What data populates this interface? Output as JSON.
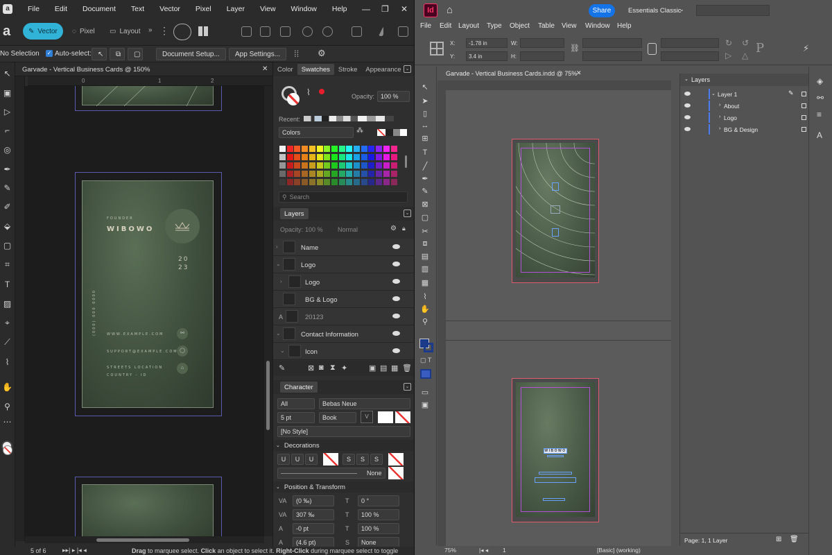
{
  "affinity": {
    "menus": [
      "File",
      "Edit",
      "Document",
      "Text",
      "Vector",
      "Pixel",
      "Layer",
      "View",
      "Window",
      "Help"
    ],
    "personas": {
      "vector": "Vector",
      "pixel": "Pixel",
      "layout": "Layout"
    },
    "context": {
      "selection": "No Selection",
      "auto_select": "Auto-select:",
      "document_setup": "Document Setup...",
      "app_settings": "App Settings..."
    },
    "doc_tab": "Garvade - Vertical Business Cards @ 150%",
    "ruler_ticks": [
      "0",
      "1",
      "2"
    ],
    "card": {
      "role": "FOUNDER",
      "name": "WIBOWO",
      "year_top": "20",
      "year_bottom": "23",
      "phone": "(000) 000 0000",
      "website": "WWW.EXAMPLE.COM",
      "email": "SUPPORT@EXAMPLE.COM",
      "street": "STREETS LOCATION",
      "country": "COUNTRY - ID"
    },
    "swatches_panel": {
      "tabs": [
        "Color",
        "Swatches",
        "Stroke",
        "Appearance"
      ],
      "selected_tab": "Swatches",
      "opacity_label": "Opacity:",
      "opacity_value": "100 %",
      "recent_label": "Recent:",
      "palette": "Colors",
      "search_placeholder": "Search"
    },
    "layers_panel": {
      "title": "Layers",
      "opacity_label": "Opacity:",
      "opacity_value": "100 %",
      "blend": "Normal",
      "rows": [
        "Name",
        "Logo",
        "Logo",
        "BG & Logo",
        "20123",
        "Contact Information",
        "Icon"
      ]
    },
    "character_panel": {
      "title": "Character",
      "scope": "All",
      "font": "Bebas Neue",
      "size": "5 pt",
      "weight": "Book",
      "style": "[No Style]",
      "decorations_title": "Decorations",
      "deco_buttons": [
        "U",
        "U",
        "U",
        "S",
        "S",
        "S"
      ],
      "deco_none": "None",
      "position_title": "Position & Transform",
      "fields": [
        {
          "label": "VA",
          "value": "(0 ‰)"
        },
        {
          "label": "T",
          "value": "0 °"
        },
        {
          "label": "VA",
          "value": "307 ‰"
        },
        {
          "label": "T",
          "value": "100 %"
        },
        {
          "label": "A",
          "value": "-0 pt"
        },
        {
          "label": "T",
          "value": "100 %"
        },
        {
          "label": "A",
          "value": "(4.6 pt)"
        },
        {
          "label": "S",
          "value": "None"
        }
      ]
    },
    "status": {
      "page": "5 of 6",
      "hint_drag": "Drag",
      "hint_1": " to marquee select. ",
      "hint_click": "Click",
      "hint_2": " an object to select it. ",
      "hint_rclick": "Right-Click",
      "hint_3": " during marquee select to toggle"
    }
  },
  "indesign": {
    "app_badge": "Id",
    "share": "Share",
    "workspace": "Essentials Classic",
    "menus": [
      "File",
      "Edit",
      "Layout",
      "Type",
      "Object",
      "Table",
      "View",
      "Window",
      "Help"
    ],
    "x_label": "X:",
    "x_value": "-1.78 in",
    "y_label": "Y:",
    "y_value": "3.4 in",
    "w_label": "W:",
    "h_label": "H:",
    "doc_tab": "Garvade - Vertical Business Cards.indd @ 75%",
    "back_name": "WIBOWO",
    "layers_panel": {
      "title": "Layers",
      "rows": [
        "Layer 1",
        "About",
        "Logo",
        "BG & Design"
      ],
      "footer": "Page: 1, 1 Layer"
    },
    "status": {
      "zoom": "75%",
      "page": "1",
      "preflight": "[Basic] (working)"
    }
  },
  "colors": {
    "affinity_accent": "#31b3d7",
    "indesign_badge": "#ff3366",
    "share": "#1473e6",
    "frame": "#e05b6f",
    "margin": "#b34fd9",
    "selection": "#6aa0ff"
  }
}
